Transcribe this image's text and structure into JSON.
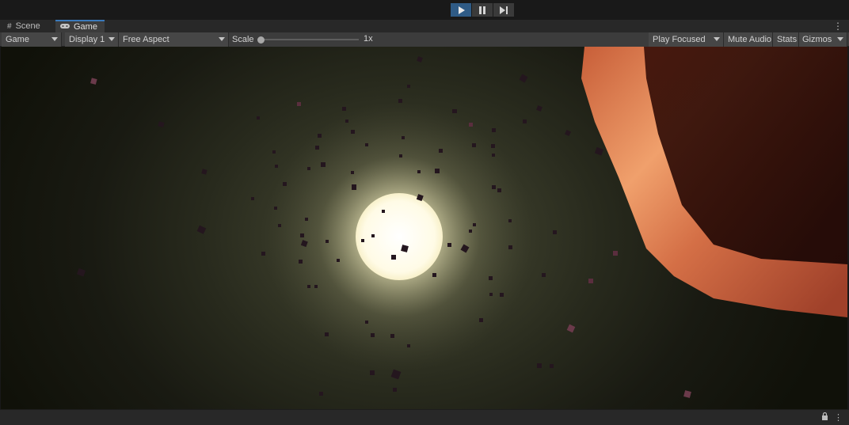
{
  "playbar": {
    "buttons": [
      {
        "icon": "play-icon",
        "active": true
      },
      {
        "icon": "pause-icon",
        "active": false
      },
      {
        "icon": "step-icon",
        "active": false
      }
    ]
  },
  "tabs": [
    {
      "label": "Scene",
      "icon": "grid-icon"
    },
    {
      "label": "Game",
      "icon": "gamepad-icon"
    }
  ],
  "toolbar": {
    "view_mode": "Game",
    "display": "Display 1",
    "aspect": "Free Aspect",
    "scale_label": "Scale",
    "scale_value": "1x",
    "play_mode": "Play Focused",
    "mute_audio": "Mute Audio",
    "stats": "Stats",
    "gizmos": "Gizmos"
  },
  "colors": {
    "accent": "#3a79bb",
    "play_active": "#2f5b86",
    "panel": "#282828",
    "toolbar": "#3c3c3c",
    "planet": "#d86f45",
    "sun": "#fffbe8"
  }
}
